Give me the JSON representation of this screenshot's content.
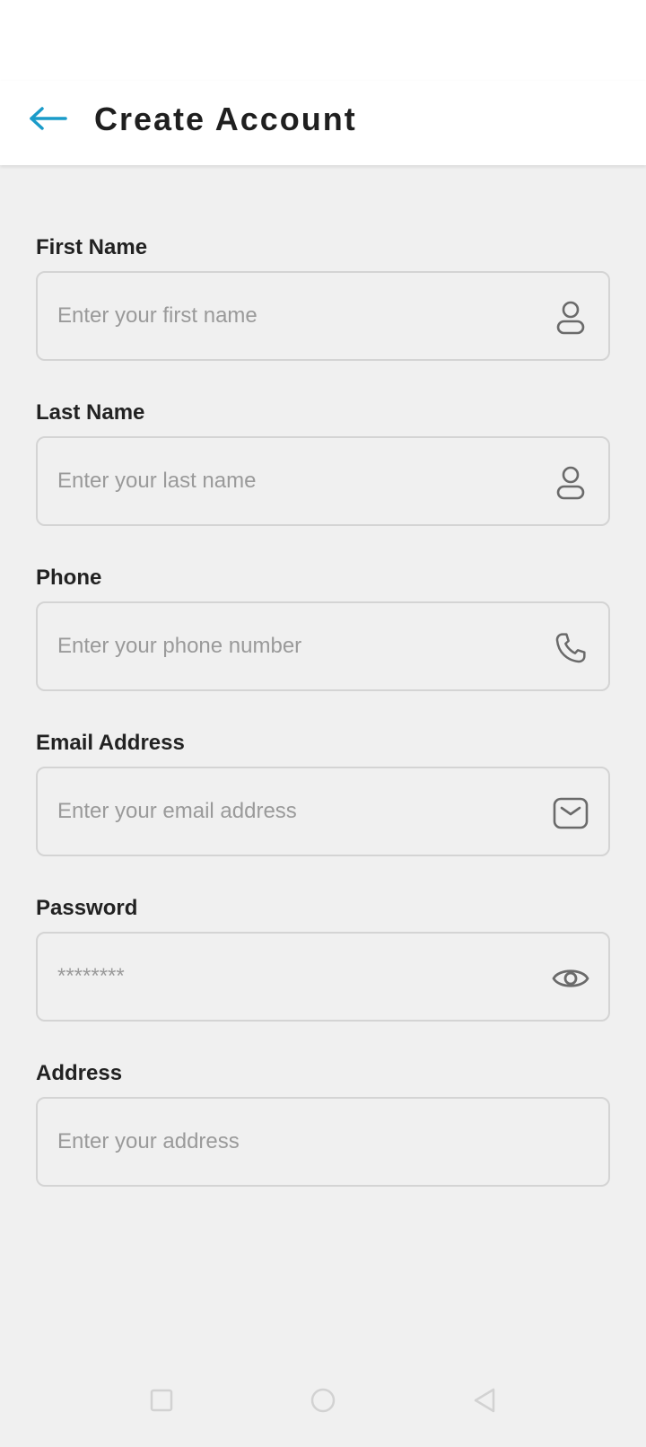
{
  "header": {
    "title": "Create Account",
    "back_icon": "arrow-left-icon",
    "accent_color": "#1a9bc9"
  },
  "form": {
    "fields": [
      {
        "label": "First Name",
        "placeholder": "Enter your first name",
        "value": "",
        "icon": "person-icon"
      },
      {
        "label": "Last Name",
        "placeholder": "Enter your last name",
        "value": "",
        "icon": "person-icon"
      },
      {
        "label": "Phone",
        "placeholder": "Enter your phone number",
        "value": "",
        "icon": "phone-icon"
      },
      {
        "label": "Email Address",
        "placeholder": "Enter your email address",
        "value": "",
        "icon": "mail-icon"
      },
      {
        "label": "Password",
        "placeholder": "********",
        "value": "",
        "icon": "eye-icon"
      },
      {
        "label": "Address",
        "placeholder": "Enter your address",
        "value": "",
        "icon": ""
      }
    ]
  },
  "navbar": {
    "items": [
      {
        "icon": "square-recents-icon"
      },
      {
        "icon": "circle-home-icon"
      },
      {
        "icon": "triangle-back-icon"
      }
    ]
  }
}
